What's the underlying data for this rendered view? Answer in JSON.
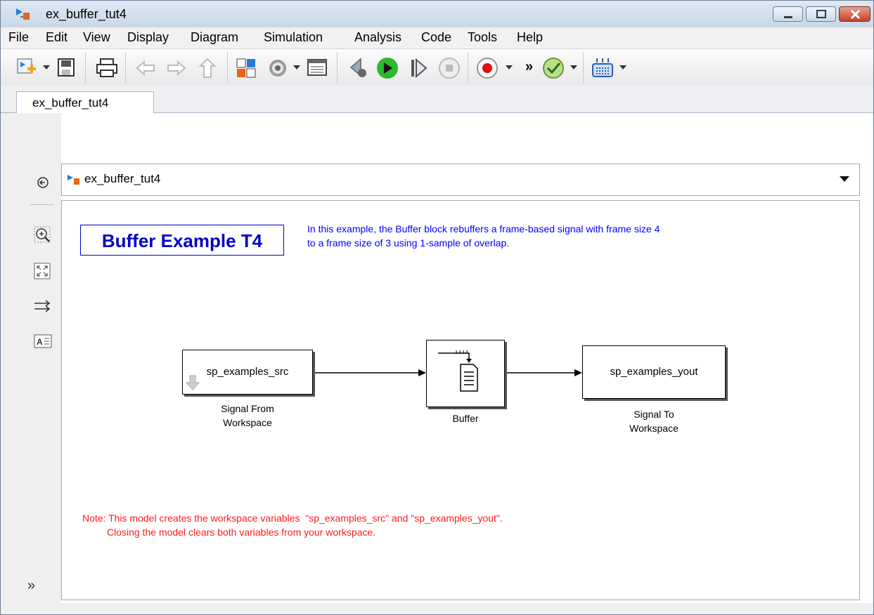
{
  "window": {
    "title": "ex_buffer_tut4",
    "controls": {
      "minimize": "minimize",
      "maximize": "maximize",
      "close": "close"
    }
  },
  "menu": [
    "File",
    "Edit",
    "View",
    "Display",
    "Diagram",
    "Simulation",
    "Analysis",
    "Code",
    "Tools",
    "Help"
  ],
  "toolbar": {
    "overflow_label": "»",
    "icons": [
      "new-model-icon",
      "save-icon",
      "print-icon",
      "back-icon",
      "forward-icon",
      "up-icon",
      "library-browser-icon",
      "model-config-icon",
      "model-explorer-icon",
      "step-back-icon",
      "run-icon",
      "step-forward-icon",
      "stop-icon",
      "record-icon",
      "check-icon",
      "build-icon"
    ]
  },
  "tab": {
    "label": "ex_buffer_tut4"
  },
  "address": {
    "path": "ex_buffer_tut4"
  },
  "palette": {
    "expand_label": "»"
  },
  "canvas": {
    "title": "Buffer Example T4",
    "description": "In this example, the Buffer block rebuffers a frame-based signal with frame size 4\nto a frame size of 3 using 1-sample of overlap.",
    "blocks": {
      "source": {
        "text": "sp_examples_src",
        "label": "Signal From\nWorkspace"
      },
      "buffer": {
        "label": "Buffer"
      },
      "sink": {
        "text": "sp_examples_yout",
        "label": "Signal To\nWorkspace"
      }
    },
    "note": "Note: This model creates the workspace variables  \"sp_examples_src\" and \"sp_examples_yout\".\n         Closing the model clears both variables from your workspace."
  },
  "colors": {
    "accent_blue": "#0000ff",
    "note_red": "#ff1a1a",
    "run_green": "#2db82d",
    "record_red": "#d11"
  }
}
